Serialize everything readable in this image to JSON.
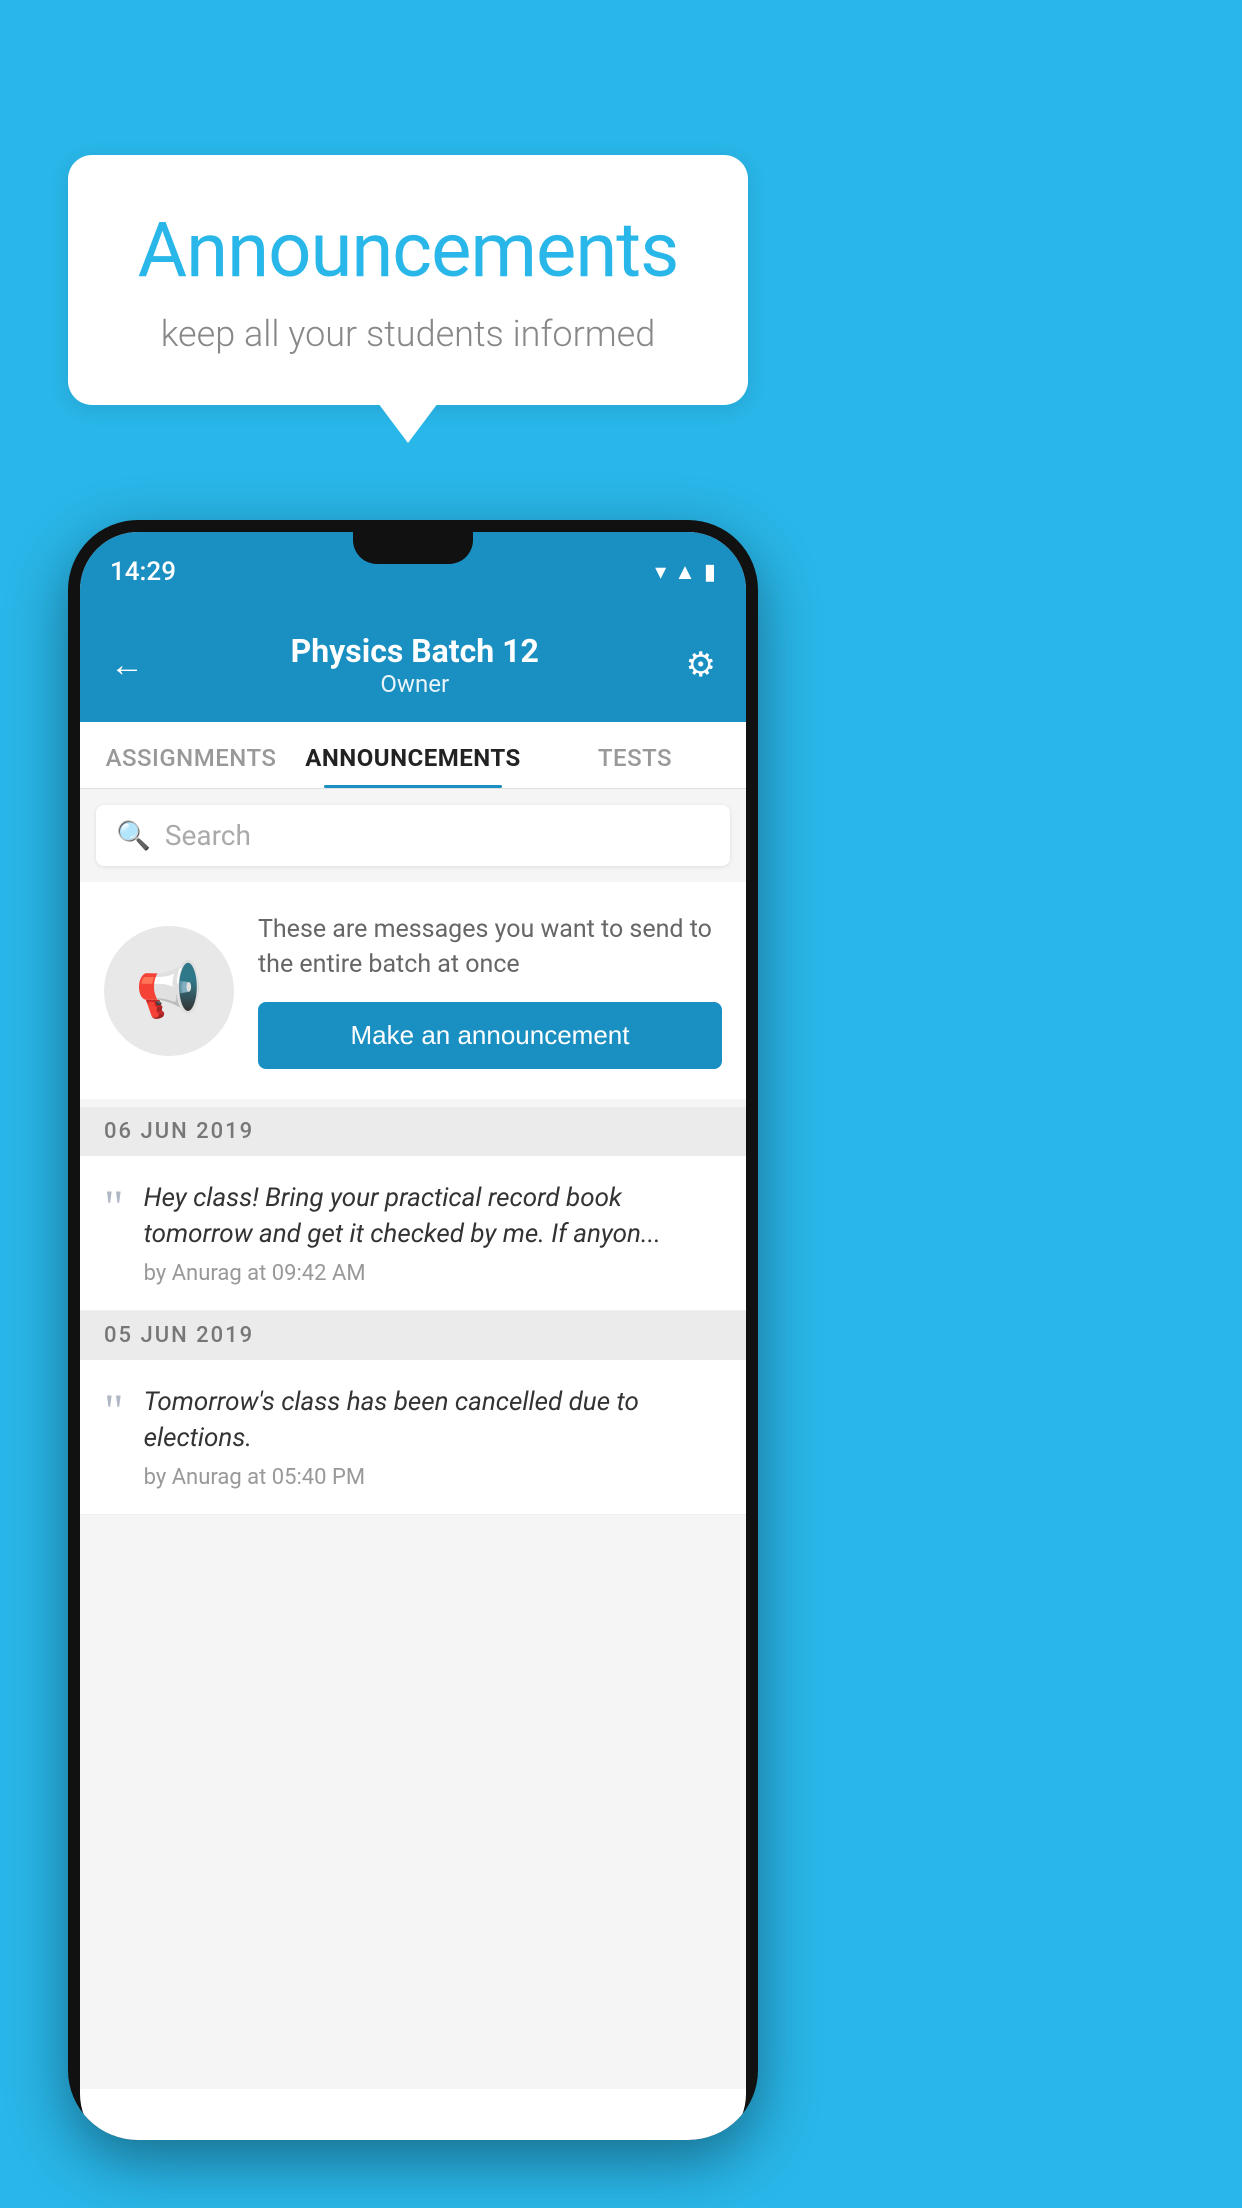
{
  "background_color": "#29b6e8",
  "speech_bubble": {
    "title": "Announcements",
    "subtitle": "keep all your students informed"
  },
  "phone": {
    "status_bar": {
      "time": "14:29",
      "icons": [
        "wifi",
        "signal",
        "battery"
      ]
    },
    "header": {
      "title": "Physics Batch 12",
      "subtitle": "Owner",
      "back_label": "←",
      "gear_label": "⚙"
    },
    "tabs": [
      {
        "label": "ASSIGNMENTS",
        "active": false
      },
      {
        "label": "ANNOUNCEMENTS",
        "active": true
      },
      {
        "label": "TESTS",
        "active": false
      }
    ],
    "search": {
      "placeholder": "Search"
    },
    "announcement_intro": {
      "description": "These are messages you want to send to the entire batch at once",
      "button_label": "Make an announcement"
    },
    "announcements": [
      {
        "date": "06  JUN  2019",
        "text": "Hey class! Bring your practical record book tomorrow and get it checked by me. If anyon...",
        "meta": "by Anurag at 09:42 AM"
      },
      {
        "date": "05  JUN  2019",
        "text": "Tomorrow's class has been cancelled due to elections.",
        "meta": "by Anurag at 05:40 PM"
      }
    ]
  }
}
